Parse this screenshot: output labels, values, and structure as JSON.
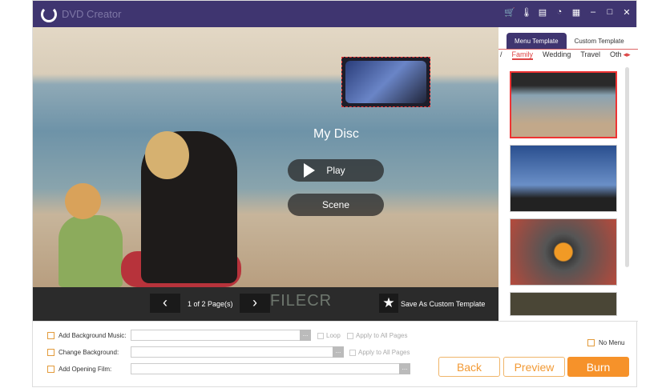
{
  "app": {
    "title": "DVD Creator",
    "title_icons": [
      "cart-icon",
      "thermometer-icon",
      "document-icon",
      "support-icon",
      "feedback-icon",
      "minimize-icon",
      "maximize-icon",
      "close-icon"
    ]
  },
  "preview": {
    "disc_title": "My Disc",
    "play_label": "Play",
    "scene_label": "Scene",
    "page_indicator": "1 of 2 Page(s)",
    "save_template_label": "Save As Custom Template",
    "watermark": "FILECR"
  },
  "right_panel": {
    "tabs": [
      "Menu Template",
      "Custom Template"
    ],
    "categories": [
      "/",
      "Family",
      "Wedding",
      "Travel",
      "Oth"
    ]
  },
  "bottom": {
    "bg_music_label": "Add Background Music:",
    "change_bg_label": "Change Background:",
    "opening_film_label": "Add Opening Film:",
    "loop_label": "Loop",
    "apply_all_label": "Apply to All Pages",
    "browse": "...",
    "no_menu_label": "No Menu",
    "back_label": "Back",
    "preview_label": "Preview",
    "burn_label": "Burn"
  }
}
